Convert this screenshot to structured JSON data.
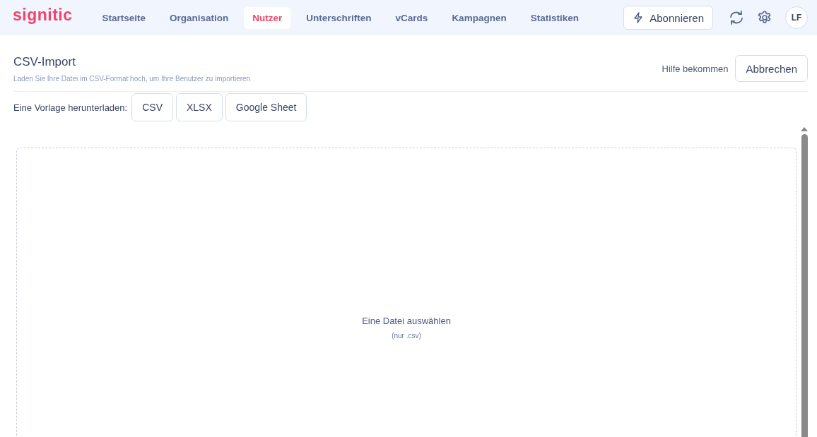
{
  "logo": "signitic",
  "nav": [
    {
      "label": "Startseite",
      "selected": false
    },
    {
      "label": "Organisation",
      "selected": false
    },
    {
      "label": "Nutzer",
      "selected": true
    },
    {
      "label": "Unterschriften",
      "selected": false
    },
    {
      "label": "vCards",
      "selected": false
    },
    {
      "label": "Kampagnen",
      "selected": false
    },
    {
      "label": "Statistiken",
      "selected": false
    }
  ],
  "subscribe_button": "Abonnieren",
  "avatar": "LF",
  "page": {
    "title": "CSV-Import",
    "subtitle": "Laden Sie Ihre Datei im CSV-Format hoch, um Ihre Benutzer zu importieren",
    "help_link": "Hilfe bekommen",
    "cancel_button": "Abbrechen"
  },
  "templates": {
    "label": "Eine Vorlage herunterladen:",
    "buttons": [
      "CSV",
      "XLSX",
      "Google Sheet"
    ]
  },
  "dropzone": {
    "title": "Eine Datei auswählen",
    "hint": "(nur .csv)"
  }
}
